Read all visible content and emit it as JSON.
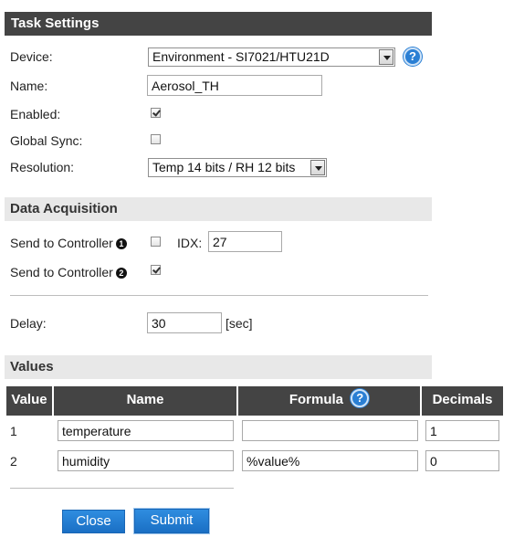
{
  "task_settings": {
    "header": "Task Settings",
    "device_label": "Device:",
    "device_value": "Environment - SI7021/HTU21D",
    "name_label": "Name:",
    "name_value": "Aerosol_TH",
    "enabled_label": "Enabled:",
    "enabled_checked": true,
    "global_sync_label": "Global Sync:",
    "global_sync_checked": false,
    "resolution_label": "Resolution:",
    "resolution_value": "Temp 14 bits / RH 12 bits",
    "help_glyph": "?"
  },
  "data_acquisition": {
    "header": "Data Acquisition",
    "send1_label": "Send to Controller",
    "send1_marker": "1",
    "send1_checked": false,
    "idx_label": "IDX:",
    "idx_value": "27",
    "send2_label": "Send to Controller",
    "send2_marker": "2",
    "send2_checked": true,
    "delay_label": "Delay:",
    "delay_value": "30",
    "delay_unit": "[sec]"
  },
  "values": {
    "header": "Values",
    "columns": {
      "value": "Value",
      "name": "Name",
      "formula": "Formula",
      "decimals": "Decimals"
    },
    "rows": [
      {
        "index": "1",
        "name": "temperature",
        "formula": "",
        "decimals": "1"
      },
      {
        "index": "2",
        "name": "humidity",
        "formula": "%value%",
        "decimals": "0"
      }
    ]
  },
  "buttons": {
    "close": "Close",
    "submit": "Submit"
  },
  "colors": {
    "header_dark": "#444444",
    "header_light": "#e8e8e8",
    "accent_blue": "#1a6fc4"
  }
}
